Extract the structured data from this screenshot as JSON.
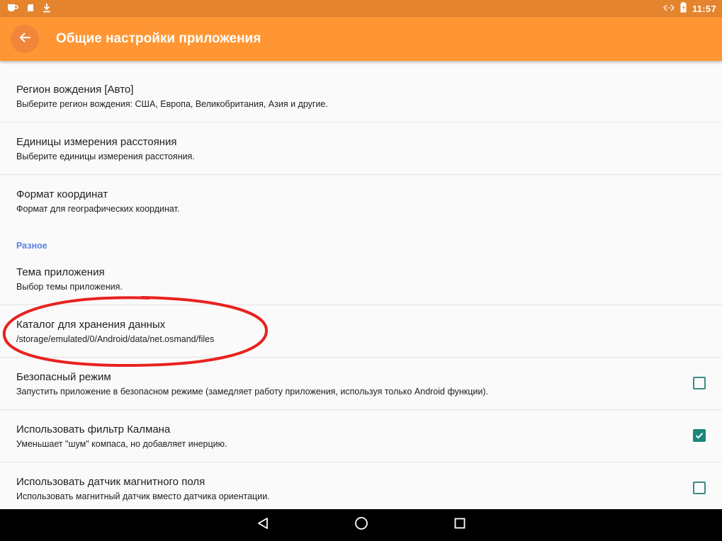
{
  "status_bar": {
    "time": "11:57",
    "left_icons": [
      "coffee-icon",
      "sd-card-icon",
      "download-icon"
    ],
    "right_icons": [
      "sync-arrows-icon",
      "battery-icon"
    ]
  },
  "app_bar": {
    "title": "Общие настройки приложения",
    "back_icon": "arrow-left-icon",
    "color": "#ff9633"
  },
  "settings": {
    "driving_region": {
      "title": "Регион вождения  [Авто]",
      "summary": "Выберите регион вождения: США, Европа, Великобритания, Азия и другие."
    },
    "distance_units": {
      "title": "Единицы измерения расстояния",
      "summary": "Выберите единицы измерения расстояния."
    },
    "coordinate_format": {
      "title": "Формат координат",
      "summary": "Формат для географических координат."
    },
    "misc_category": "Разное",
    "app_theme": {
      "title": "Тема приложения",
      "summary": "Выбор темы приложения."
    },
    "storage_folder": {
      "title": "Каталог для хранения данных",
      "summary": "/storage/emulated/0/Android/data/net.osmand/files"
    },
    "safe_mode": {
      "title": "Безопасный режим",
      "summary": "Запустить приложение в безопасном режиме (замедляет работу приложения, используя только Android функции).",
      "checked": false
    },
    "kalman_filter": {
      "title": "Использовать фильтр Калмана",
      "summary": "Уменьшает \"шум\" компаса, но добавляет инерцию.",
      "checked": true
    },
    "magnetic_sensor": {
      "title": "Использовать датчик магнитного поля",
      "summary": "Использовать магнитный датчик вместо датчика ориентации.",
      "checked": false
    }
  },
  "annotation": {
    "highlight_color": "#e8221e"
  },
  "nav_bar": {
    "buttons": [
      "back-triangle-icon",
      "home-circle-icon",
      "recents-square-icon"
    ]
  }
}
